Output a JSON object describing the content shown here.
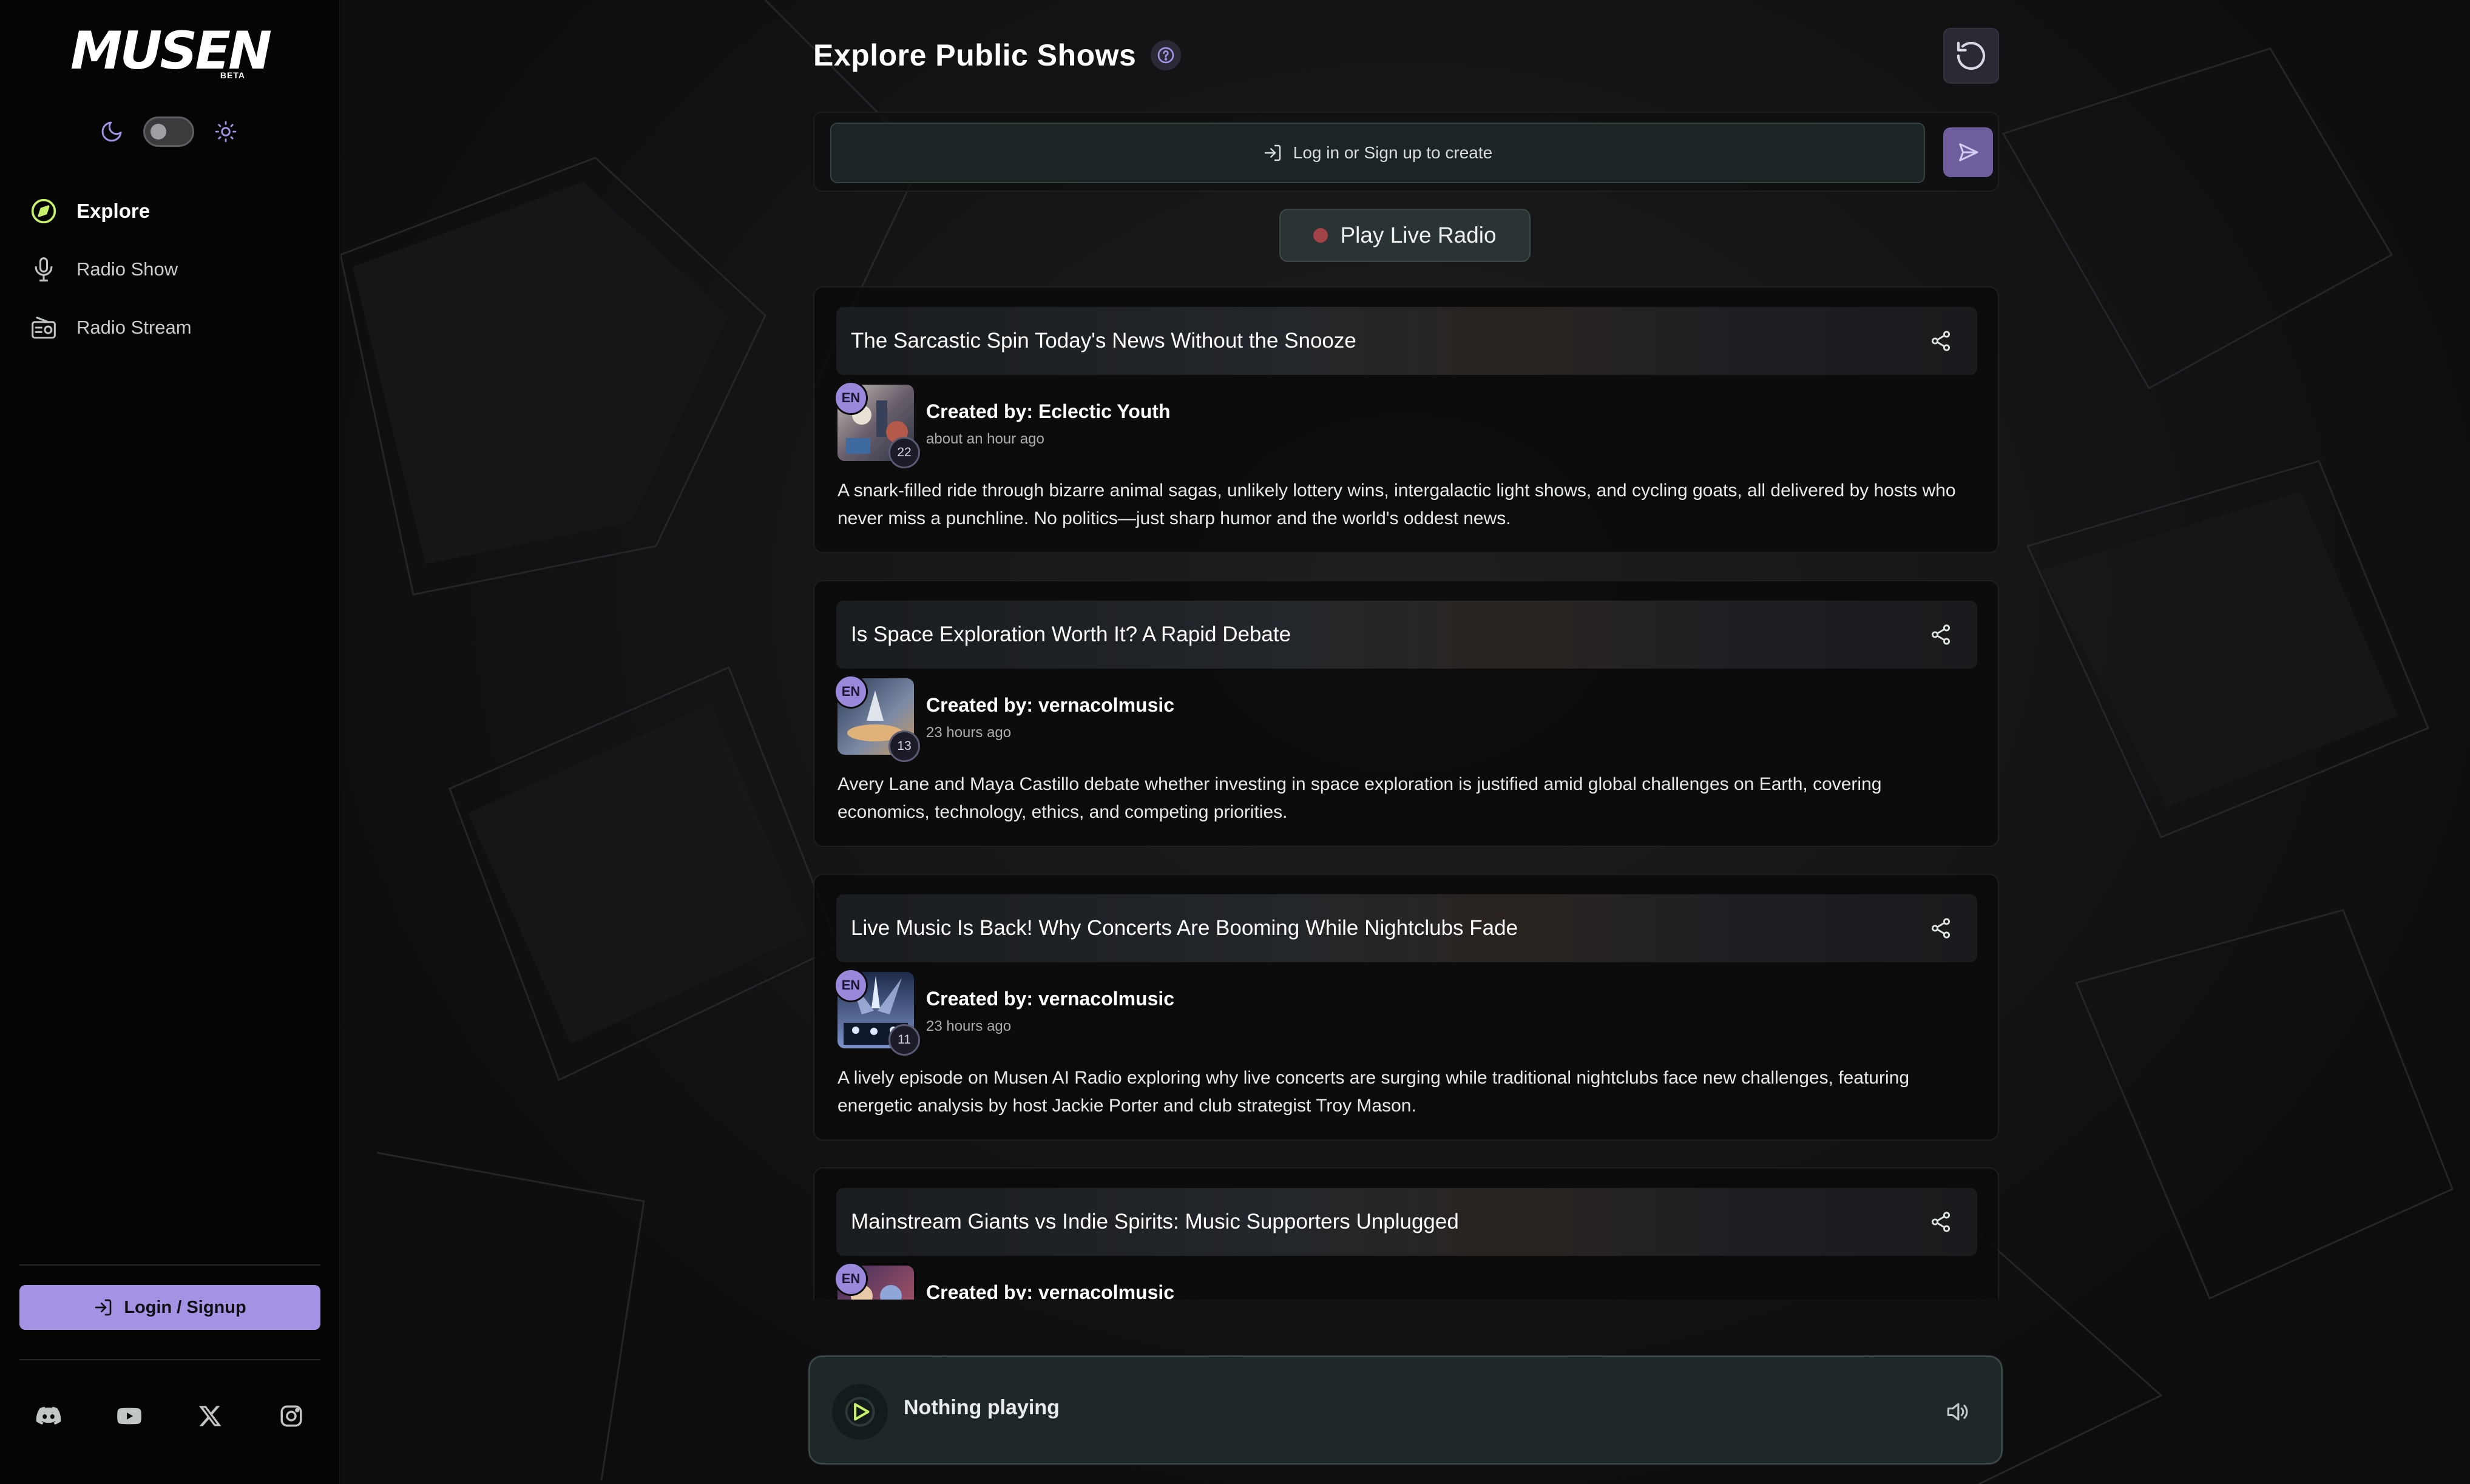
{
  "brand": {
    "logo_text": "MUSEN",
    "beta_label": "BETA"
  },
  "colors": {
    "accent": "#a493e4",
    "nav_active_icon": "#c9f26b",
    "live_dot": "#b9474a"
  },
  "sidebar": {
    "theme_toggle": {
      "left_icon": "moon-icon",
      "right_icon": "sun-icon",
      "state": "dark"
    },
    "items": [
      {
        "label": "Explore",
        "icon": "compass-icon",
        "active": true
      },
      {
        "label": "Radio Show",
        "icon": "microphone-icon",
        "active": false
      },
      {
        "label": "Radio Stream",
        "icon": "radio-icon",
        "active": false
      }
    ],
    "login_label": "Login / Signup",
    "socials": [
      "discord-icon",
      "youtube-icon",
      "x-icon",
      "instagram-icon"
    ]
  },
  "header": {
    "title": "Explore Public Shows",
    "help_icon": "question-icon",
    "refresh_icon": "refresh-icon"
  },
  "create": {
    "prompt_label": "Log in or Sign up to create",
    "send_icon": "send-icon"
  },
  "live_radio": {
    "label": "Play Live Radio"
  },
  "shows": [
    {
      "title": "The Sarcastic Spin Today's News Without the Snooze",
      "lang": "EN",
      "count": "22",
      "creator": "Created by: Eclectic Youth",
      "time": "about an hour ago",
      "description": "A snark-filled ride through bizarre animal sagas, unlikely lottery wins, intergalactic light shows, and cycling goats, all delivered by hosts who never miss a punchline. No politics—just sharp humor and the world's oddest news."
    },
    {
      "title": "Is Space Exploration Worth It? A Rapid Debate",
      "lang": "EN",
      "count": "13",
      "creator": "Created by: vernacolmusic",
      "time": "23 hours ago",
      "description": "Avery Lane and Maya Castillo debate whether investing in space exploration is justified amid global challenges on Earth, covering economics, technology, ethics, and competing priorities."
    },
    {
      "title": "Live Music Is Back! Why Concerts Are Booming While Nightclubs Fade",
      "lang": "EN",
      "count": "11",
      "creator": "Created by: vernacolmusic",
      "time": "23 hours ago",
      "description": "A lively episode on Musen AI Radio exploring why live concerts are surging while traditional nightclubs face new challenges, featuring energetic analysis by host Jackie Porter and club strategist Troy Mason."
    },
    {
      "title": "Mainstream Giants vs Indie Spirits: Music Supporters Unplugged",
      "lang": "EN",
      "creator": "Created by: vernacolmusic"
    }
  ],
  "player": {
    "status": "Nothing playing",
    "play_icon": "play-icon",
    "volume_icon": "volume-icon"
  }
}
